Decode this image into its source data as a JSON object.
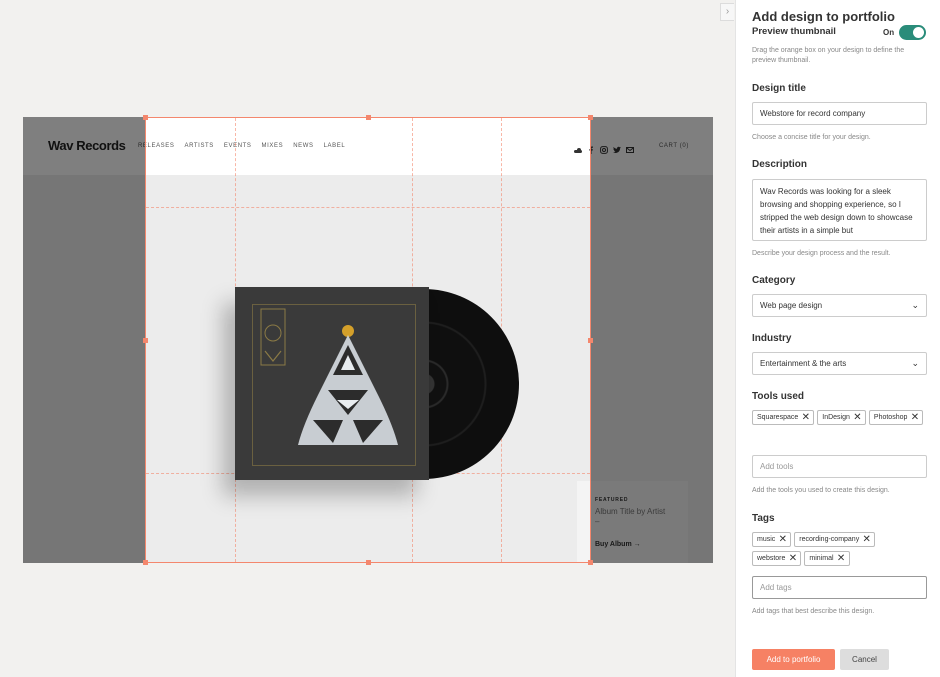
{
  "canvas": {
    "collapse_glyph": "›",
    "site": {
      "logo": "Wav Records",
      "nav": [
        "RELEASES",
        "ARTISTS",
        "EVENTS",
        "MIXES",
        "NEWS",
        "LABEL"
      ],
      "social_icons": [
        "soundcloud-icon",
        "facebook-icon",
        "instagram-icon",
        "twitter-icon",
        "mail-icon"
      ],
      "cart": "CART (0)",
      "featured": {
        "kicker": "FEATURED",
        "title": "Album Title by Artist",
        "dash": "–",
        "buy": "Buy Album →"
      }
    }
  },
  "panel": {
    "title": "Add design to portfolio",
    "preview": {
      "label": "Preview thumbnail",
      "toggle_label": "On",
      "toggle_state": "on",
      "help": "Drag the orange box on your design to define the preview thumbnail."
    },
    "design_title": {
      "label": "Design title",
      "value": "Webstore for record company",
      "help": "Choose a concise title for your design."
    },
    "description": {
      "label": "Description",
      "value": "Wav Records was looking for a sleek browsing and shopping experience, so I stripped the web design down to showcase their artists in a simple but",
      "help": "Describe your design process and the result."
    },
    "category": {
      "label": "Category",
      "value": "Web page design"
    },
    "industry": {
      "label": "Industry",
      "value": "Entertainment & the arts"
    },
    "tools": {
      "label": "Tools used",
      "chips": [
        "Squarespace",
        "InDesign",
        "Photoshop"
      ],
      "placeholder": "Add tools",
      "help": "Add the tools you used to create this design."
    },
    "tags": {
      "label": "Tags",
      "chips": [
        "music",
        "recording-company",
        "webstore",
        "minimal"
      ],
      "placeholder": "Add tags",
      "help": "Add tags that best describe this design."
    },
    "remove_glyph": "✕",
    "chevron_glyph": "⌄",
    "buttons": {
      "add": "Add to portfolio",
      "cancel": "Cancel"
    }
  },
  "colors": {
    "accent": "#f68164",
    "crop_border": "#f4876d",
    "toggle_on": "#2a8c7a"
  }
}
